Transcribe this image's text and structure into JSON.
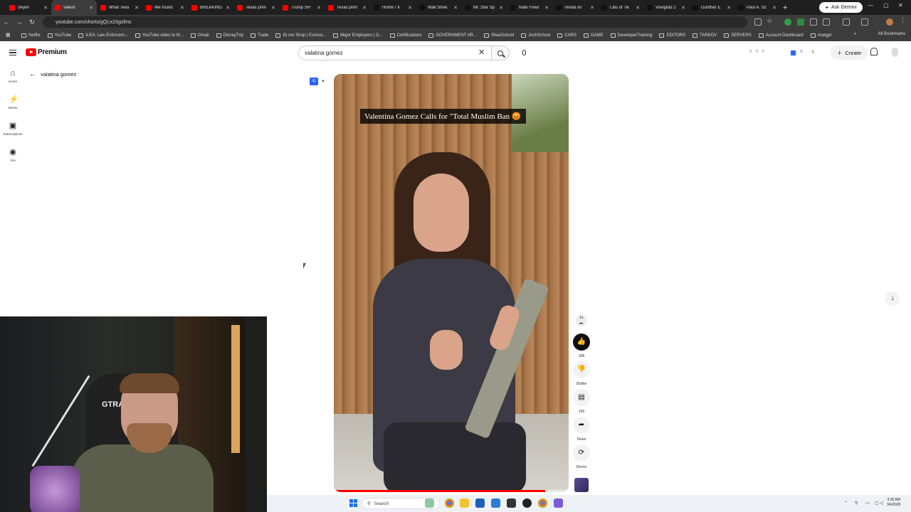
{
  "browser": {
    "tabs": [
      {
        "label": "Skylin",
        "color": "#ff0000"
      },
      {
        "label": "Valent",
        "color": "#ff0000"
      },
      {
        "label": "What Texa",
        "color": "#ff0000"
      },
      {
        "label": "We found",
        "color": "#ff0000"
      },
      {
        "label": "BREAKING",
        "color": "#ff0000"
      },
      {
        "label": "Texas prim",
        "color": "#ff0000"
      },
      {
        "label": "Trump SH",
        "color": "#ff0000"
      },
      {
        "label": "Texas prim",
        "color": "#ff0000"
      },
      {
        "label": "Home / X",
        "color": "#111111"
      },
      {
        "label": "Wall Stree",
        "color": "#111111"
      },
      {
        "label": "Mr. Star Sp",
        "color": "#111111"
      },
      {
        "label": "Nate Fried",
        "color": "#111111"
      },
      {
        "label": "Vivida on",
        "color": "#111111"
      },
      {
        "label": "Libs of Tik",
        "color": "#111111"
      },
      {
        "label": "Visegrád 2",
        "color": "#111111"
      },
      {
        "label": "Gunther E",
        "color": "#111111"
      },
      {
        "label": "Paul A. Sz",
        "color": "#111111"
      }
    ],
    "active_tab_index": 1,
    "ask_gemini": "Ask Gemini",
    "url": "youtube.com/shorts/gQLe23gsfms",
    "bookmarks": [
      "Netflix",
      "YouTube",
      "ILEA: Law Enforcem...",
      "YouTube video to M...",
      "Gmail",
      "DisneyTrip",
      "Trade",
      "ID.me Shop | Exclusi...",
      "Major Employers | G...",
      "Certifications",
      "GOVERNMENT AR...",
      "ShaeSchool",
      "JoshSchool",
      "CARS",
      "GAME",
      "DeveloperTraining",
      "EDITORS",
      "TARKOV",
      "SERVERS",
      "Account Dashboard",
      "chatgpt"
    ],
    "all_bookmarks": "All Bookmarks"
  },
  "youtube": {
    "brand": "Premium",
    "search_query": "valatina gomez",
    "create_label": "Create",
    "ext_counts": "0 · 0 · 0",
    "guide": [
      {
        "label": "Home",
        "icon": "home-icon",
        "glyph": "⌂"
      },
      {
        "label": "Shorts",
        "icon": "shorts-icon",
        "glyph": "⚡"
      },
      {
        "label": "Subscriptions",
        "icon": "subscriptions-icon",
        "glyph": "▣"
      },
      {
        "label": "You",
        "icon": "you-icon",
        "glyph": "◉"
      }
    ],
    "back_label": "valatina gomez",
    "player_badge": "iQ"
  },
  "short": {
    "caption": "Valentina Gomez Calls for \"Total Muslim Ban 😡",
    "progress": 0.9
  },
  "actions": {
    "speed": "1x",
    "like_count": "308",
    "dislike_label": "Dislike",
    "comment_count": "169",
    "share_label": "Share",
    "remix_label": "Remix"
  },
  "webcam": {
    "chair_brand": "GTRAC"
  },
  "taskbar": {
    "search_placeholder": "Search",
    "time": "3:35 AM",
    "date": "3/4/2026"
  }
}
